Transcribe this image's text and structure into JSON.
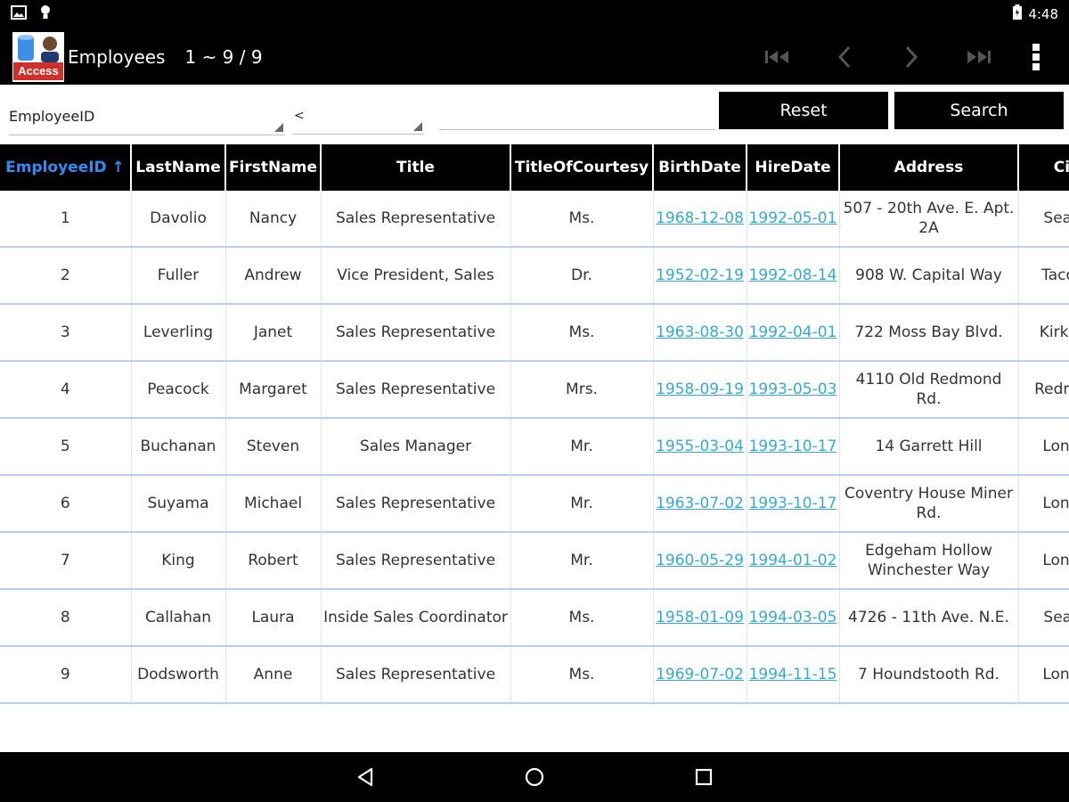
{
  "status_bar": {
    "time": "4:48",
    "icons": [
      "image-icon",
      "bulb-icon",
      "battery-icon"
    ]
  },
  "app_bar": {
    "icon_text": "Access",
    "title": "Employees",
    "range": "1 ~ 9 / 9",
    "nav": [
      "first-page-icon",
      "prev-page-icon",
      "next-page-icon",
      "last-page-icon"
    ],
    "overflow": "overflow-menu-icon"
  },
  "filter": {
    "field": "EmployeeID",
    "operator": "<",
    "value": "",
    "reset_label": "Reset",
    "search_label": "Search"
  },
  "table": {
    "sort_column": "EmployeeID",
    "sort_direction": "ascending",
    "sort_arrow": "↑",
    "columns": [
      "EmployeeID",
      "LastName",
      "FirstName",
      "Title",
      "TitleOfCourtesy",
      "BirthDate",
      "HireDate",
      "Address",
      "City"
    ],
    "rows": [
      [
        "1",
        "Davolio",
        "Nancy",
        "Sales Representative",
        "Ms.",
        "1968-12-08",
        "1992-05-01",
        "507 - 20th Ave. E. Apt. 2A",
        "Seattle"
      ],
      [
        "2",
        "Fuller",
        "Andrew",
        "Vice President, Sales",
        "Dr.",
        "1952-02-19",
        "1992-08-14",
        "908 W. Capital Way",
        "Tacoma"
      ],
      [
        "3",
        "Leverling",
        "Janet",
        "Sales Representative",
        "Ms.",
        "1963-08-30",
        "1992-04-01",
        "722 Moss Bay Blvd.",
        "Kirkland"
      ],
      [
        "4",
        "Peacock",
        "Margaret",
        "Sales Representative",
        "Mrs.",
        "1958-09-19",
        "1993-05-03",
        "4110 Old Redmond Rd.",
        "Redmond"
      ],
      [
        "5",
        "Buchanan",
        "Steven",
        "Sales Manager",
        "Mr.",
        "1955-03-04",
        "1993-10-17",
        "14 Garrett Hill",
        "London"
      ],
      [
        "6",
        "Suyama",
        "Michael",
        "Sales Representative",
        "Mr.",
        "1963-07-02",
        "1993-10-17",
        "Coventry House Miner Rd.",
        "London"
      ],
      [
        "7",
        "King",
        "Robert",
        "Sales Representative",
        "Mr.",
        "1960-05-29",
        "1994-01-02",
        "Edgeham Hollow Winchester Way",
        "London"
      ],
      [
        "8",
        "Callahan",
        "Laura",
        "Inside Sales Coordinator",
        "Ms.",
        "1958-01-09",
        "1994-03-05",
        "4726 - 11th Ave. N.E.",
        "Seattle"
      ],
      [
        "9",
        "Dodsworth",
        "Anne",
        "Sales Representative",
        "Ms.",
        "1969-07-02",
        "1994-11-15",
        "7 Houndstooth Rd.",
        "London"
      ]
    ]
  },
  "colors": {
    "bar_bg": "#000000",
    "sorted_header": "#2f8df5",
    "date_link": "#34a8d8",
    "row_divider": "#b9cfee"
  },
  "system_nav": [
    "back-icon",
    "home-icon",
    "recents-icon"
  ]
}
